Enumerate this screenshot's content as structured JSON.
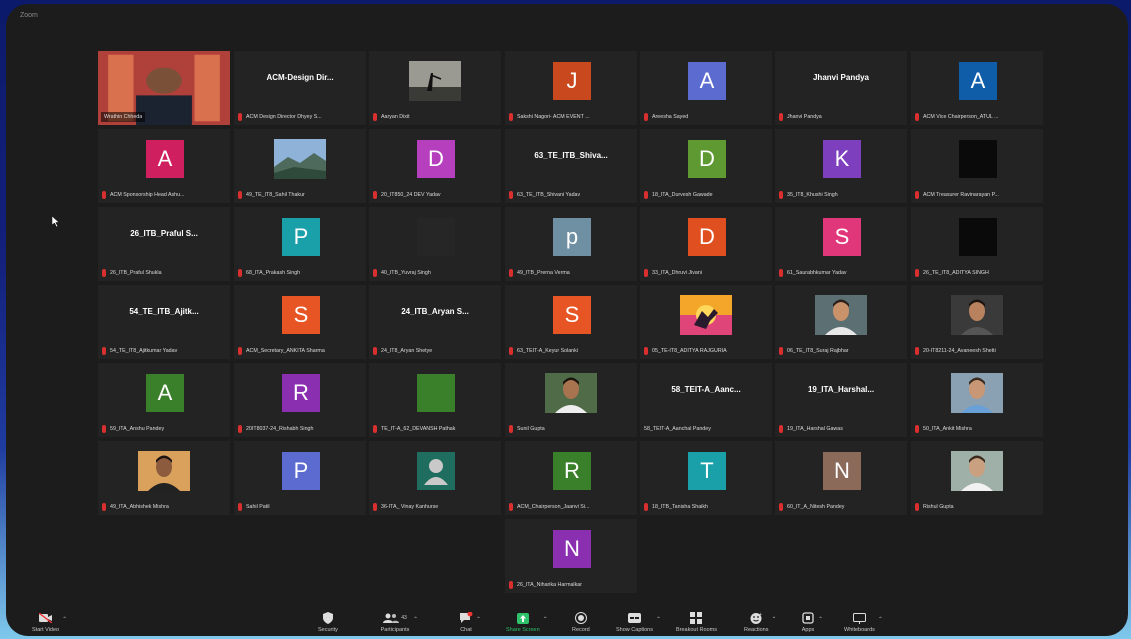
{
  "window": {
    "title": "Zoom"
  },
  "tiles": [
    {
      "label": "Wrathin Chheda",
      "video": "room",
      "active": true,
      "mic": false
    },
    {
      "label": "ACM Design Director Dhyey S...",
      "card": "ACM-Design  Dir...",
      "mic": true
    },
    {
      "label": "Aaryan Dixit",
      "video": "sky",
      "mic": true
    },
    {
      "label": "Sakshi Nagori- ACM EVENT ...",
      "avatar": "J",
      "color": "#c9481d",
      "mic": true
    },
    {
      "label": "Areesha Sayed",
      "avatar": "A",
      "color": "#5b6bcf",
      "mic": true
    },
    {
      "label": "Jhanvi Pandya",
      "card": "Jhanvi Pandya",
      "mic": true
    },
    {
      "label": "ACM Vice Chairperson_ATUL ...",
      "avatar": "A",
      "color": "#0f5ca8",
      "mic": true
    },
    {
      "label": "ACM Sponsorship Head Ashu...",
      "avatar": "A",
      "color": "#cf1f5e",
      "mic": true
    },
    {
      "label": "49_TE_IT8_Sahil Thakur",
      "video": "mountain",
      "mic": true
    },
    {
      "label": "20_IT850_24 DEV Yadav",
      "avatar": "D",
      "color": "#b53fbd",
      "mic": true
    },
    {
      "label": "63_TE_ITB_Shivani Yadav",
      "card": "63_TE_ITB_Shiva...",
      "mic": true
    },
    {
      "label": "18_ITA_Durvesh Gawade",
      "avatar": "D",
      "color": "#5e9a31",
      "mic": true
    },
    {
      "label": "35_IT8_Khushi Singh",
      "avatar": "K",
      "color": "#7d3fbe",
      "mic": true
    },
    {
      "label": "ACM Treasurer Ravinarayan P...",
      "avatar": "",
      "color": "#0a0a0a",
      "mic": true
    },
    {
      "label": "26_ITB_Praful Shukla",
      "card": "26_ITB_Praful  S...",
      "mic": true
    },
    {
      "label": "68_ITA_Prakash Singh",
      "avatar": "P",
      "color": "#1aa0a8",
      "mic": true
    },
    {
      "label": "40_ITB_Yuvraj Singh",
      "avatar": "",
      "color": "#262626",
      "mic": true
    },
    {
      "label": "49_ITB_Prerna Verma",
      "avatar": "p",
      "color": "#6f8fa3",
      "mic": true
    },
    {
      "label": "33_ITA_Dhruvi Jivani",
      "avatar": "D",
      "color": "#e04f1f",
      "mic": true
    },
    {
      "label": "61_Saurabhkumar Yadav",
      "avatar": "S",
      "color": "#e0367a",
      "mic": true
    },
    {
      "label": "26_TE_IT8_ADITYA SINGH",
      "avatar": "",
      "color": "#0a0a0a",
      "mic": true
    },
    {
      "label": "54_TE_IT8_Ajitkumar Yadav",
      "card": "54_TE_ITB_Ajitk...",
      "mic": true
    },
    {
      "label": "ACM_Secretary_ANKITA Sharma",
      "avatar": "S",
      "color": "#e65523",
      "mic": true
    },
    {
      "label": "24_IT8_Aryan Shetye",
      "card": "24_ITB_Aryan  S...",
      "mic": true
    },
    {
      "label": "63_TEIT-A_Keyur Solanki",
      "avatar": "S",
      "color": "#e65523",
      "mic": true
    },
    {
      "label": "05_TE-IT8_ADITYA RAJGURIA",
      "video": "sunset",
      "mic": true
    },
    {
      "label": "06_TE_IT8_Suraj Rajbhar",
      "video": "face",
      "mic": true
    },
    {
      "label": "20-IT8211-24_Avaneesh Shetti",
      "video": "face2",
      "mic": true
    },
    {
      "label": "59_ITA_Anshu Pandey",
      "avatar": "A",
      "color": "#3a7f2a",
      "mic": true
    },
    {
      "label": "20IT8037-24_Rishabh Singh",
      "avatar": "R",
      "color": "#8a2fb0",
      "mic": true
    },
    {
      "label": "TE_IT-A_62_DEVANSH Pathak",
      "avatar": "",
      "color": "#3a7f2a",
      "mic": true
    },
    {
      "label": "Sunil Gupta",
      "video": "face3",
      "mic": true
    },
    {
      "label": "58_TEIT-A_Aanchal Pandey",
      "card": "58_TEIT-A_Aanc...",
      "mic": false
    },
    {
      "label": "19_ITA_Harshal Gawas",
      "card": "19_ITA_Harshal...",
      "mic": true
    },
    {
      "label": "50_ITA_Ankit Mishra",
      "video": "face4",
      "mic": true
    },
    {
      "label": "49_ITA_Abhishek Mishra",
      "video": "face5",
      "mic": true
    },
    {
      "label": "Sahil Patil",
      "avatar": "P",
      "color": "#5b6bcf",
      "mic": true
    },
    {
      "label": "36-ITA_ Vinay Kanhurse",
      "avatar": "person",
      "color": "#1f6d5e",
      "mic": true
    },
    {
      "label": "ACM_Chairperson_Jaanvi Si...",
      "avatar": "R",
      "color": "#3a7f2a",
      "mic": true
    },
    {
      "label": "18_ITB_Tanisha Shaikh",
      "avatar": "T",
      "color": "#1aa0a8",
      "mic": true
    },
    {
      "label": "60_IT_A_Nitesh Pandey",
      "avatar": "N",
      "color": "#8b6a5a",
      "mic": true
    },
    {
      "label": "Rishul Gupta",
      "video": "face6",
      "mic": true
    },
    {
      "label": "26_ITA_Niharika Harmalkar",
      "avatar": "N",
      "color": "#8a2fb0",
      "mic": true
    }
  ],
  "toolbar": {
    "start_video": "Start Video",
    "security": "Security",
    "participants": "Participants",
    "participants_count": "43",
    "chat": "Chat",
    "share_screen": "Share Screen",
    "record": "Record",
    "show_captions": "Show Captions",
    "breakout_rooms": "Breakout Rooms",
    "reactions": "Reactions",
    "apps": "Apps",
    "whiteboards": "Whiteboards"
  },
  "colors": {
    "accent_green": "#2ec26a",
    "active_speaker": "#c8d52b",
    "mic_muted": "#d92f2f"
  }
}
